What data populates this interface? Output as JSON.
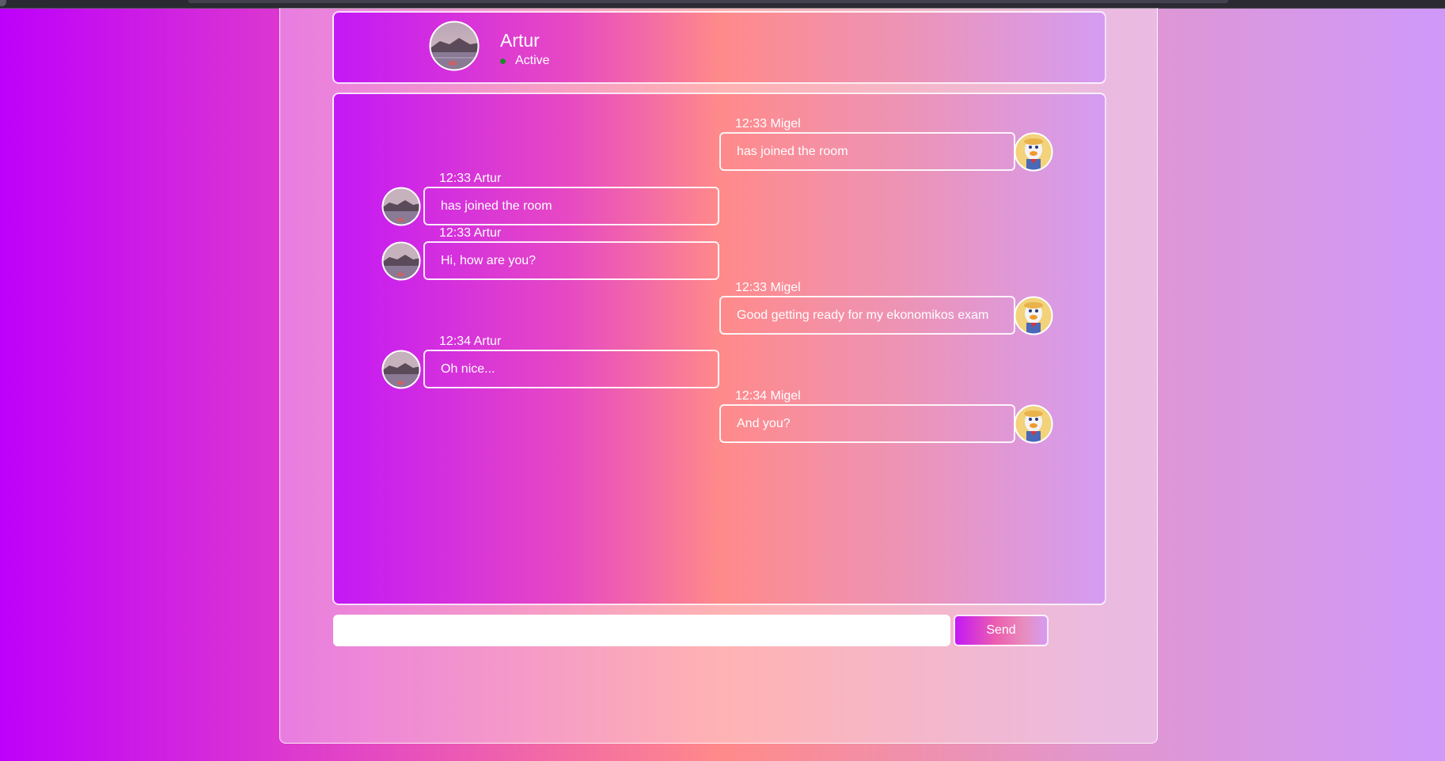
{
  "header": {
    "name": "Artur",
    "status": "Active",
    "avatar_icon": "mountain-lake-photo-avatar"
  },
  "messages": [
    {
      "side": "right",
      "time": "12:33",
      "author": "Migel",
      "meta": "12:33 Migel",
      "text": "has joined the room",
      "avatar_icon": "duck-avatar"
    },
    {
      "side": "left",
      "time": "12:33",
      "author": "Artur",
      "meta": "12:33 Artur",
      "text": "has joined the room",
      "avatar_icon": "mountain-lake-photo-avatar"
    },
    {
      "side": "left",
      "time": "12:33",
      "author": "Artur",
      "meta": "12:33 Artur",
      "text": "Hi, how are you?",
      "avatar_icon": "mountain-lake-photo-avatar"
    },
    {
      "side": "right",
      "time": "12:33",
      "author": "Migel",
      "meta": "12:33 Migel",
      "text": "Good getting ready for my ekonomikos exam",
      "avatar_icon": "duck-avatar"
    },
    {
      "side": "left",
      "time": "12:34",
      "author": "Artur",
      "meta": "12:34 Artur",
      "text": "Oh nice...",
      "avatar_icon": "mountain-lake-photo-avatar"
    },
    {
      "side": "right",
      "time": "12:34",
      "author": "Migel",
      "meta": "12:34 Migel",
      "text": "And you?",
      "avatar_icon": "duck-avatar"
    }
  ],
  "composer": {
    "value": "",
    "placeholder": "",
    "send_label": "Send"
  },
  "colors": {
    "status_active": "#1f8a2a",
    "gradient_start": "#be00fb",
    "gradient_mid": "#ff8a8a",
    "gradient_end": "#cf99fa"
  }
}
